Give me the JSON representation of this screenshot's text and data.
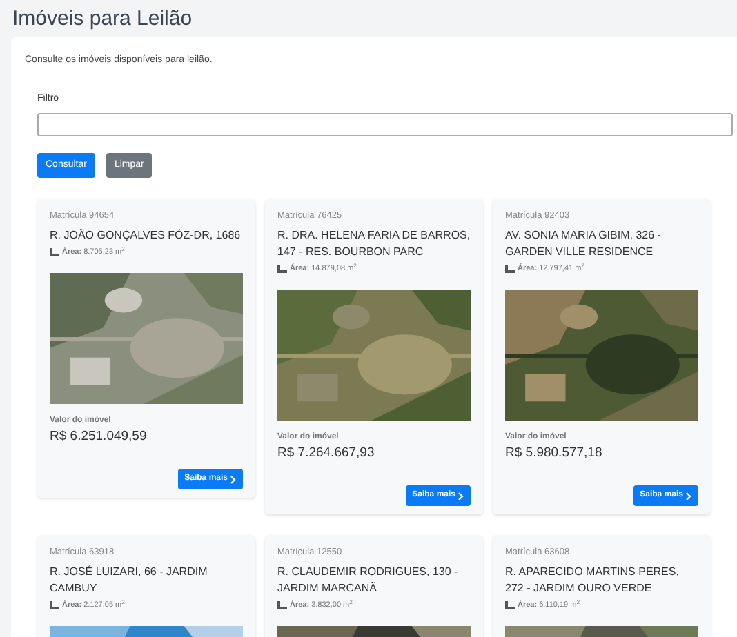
{
  "page": {
    "title": "Imóveis para Leilão",
    "description": "Consulte os imóveis disponíveis para leilão."
  },
  "filter": {
    "label": "Filtro"
  },
  "buttons": [
    {
      "label": "Consultar",
      "kind": "primary"
    },
    {
      "label": "Limpar",
      "kind": "secondary"
    }
  ],
  "properties": [
    {
      "registration": "Matrícula 94654",
      "address": "R. JOÃO GONÇALVES FÓZ-DR, 1686",
      "area": "**Área:** 8.705,23 m$^{2}$",
      "value_label": "Valor do imóvel",
      "value": "R$ 6.251.049,59",
      "button": "Saiba mais"
    },
    {
      "registration": "Matrícula 76425",
      "address": "R. DRA. HELENA FARIA DE BARROS, 147 - RES. BOURBON PARC",
      "area": "**Área:** 14.879,08 m$^{2}$",
      "value_label": "Valor do imóvel",
      "value": "R$ 7.264.667,93",
      "button": "Saiba mais"
    },
    {
      "registration": "Matrícula 92403",
      "address": "AV. SONIA MARIA GIBIM, 326 - GARDEN VILLE RESIDENCE",
      "area": "**Área:** 12.797,41 m$^{2}$",
      "value_label": "Valor do imóvel",
      "value": "R$ 5.980.577,18",
      "button": "Saiba mais"
    },
    {
      "registration": "Matrícula 63918",
      "address": "R. JOSÉ LUIZARI, 66 - JARDIM CAMBUY",
      "area": "**Área:** 2.127,05 m$^{2}$"
    },
    {
      "registration": "Matrícula 12550",
      "address": "R. CLAUDEMIR RODRIGUES, 130 - JARDIM MARCANÃ",
      "area": "**Área:** 3.832,00 m$^{2}$"
    },
    {
      "registration": "Matrícula 63608",
      "address": "R. APARECIDO MARTINS PERES, 272 - JARDIM OURO VERDE",
      "area": "**Área:** 6.110,19 m$^{2}$"
    }
  ]
}
